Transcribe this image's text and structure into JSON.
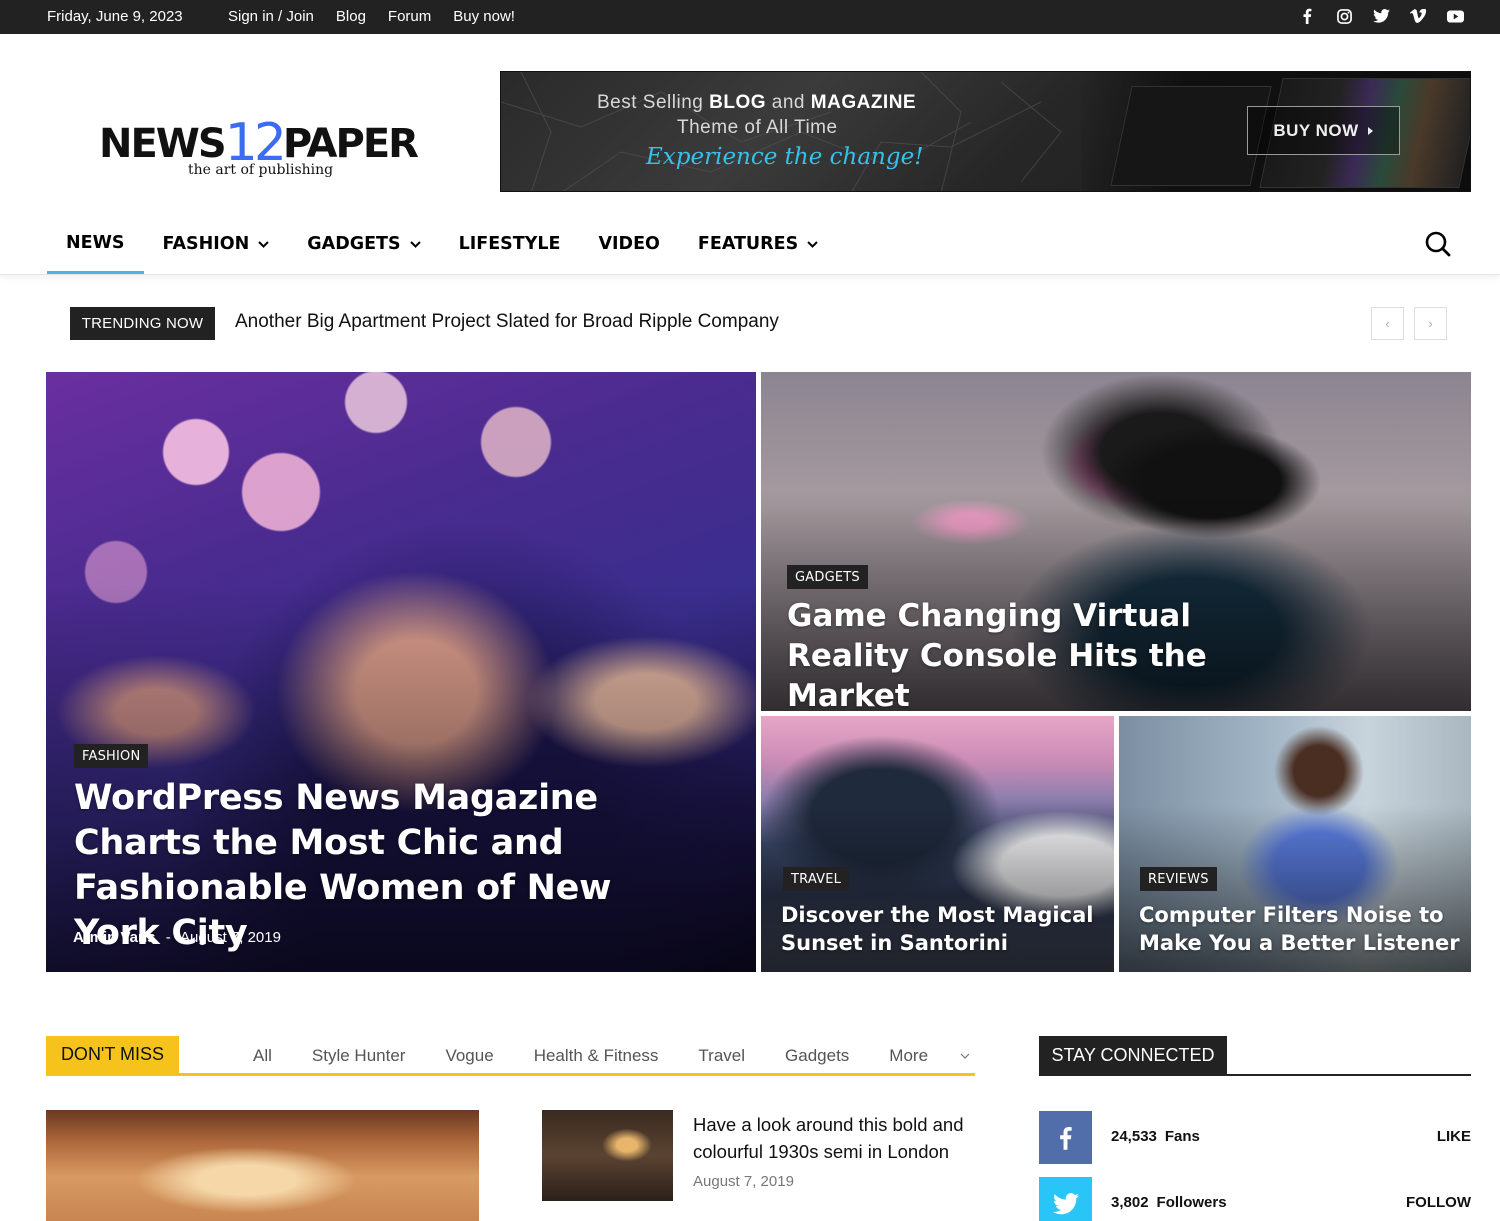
{
  "topbar": {
    "date": "Friday, June 9, 2023",
    "links": [
      "Sign in / Join",
      "Blog",
      "Forum",
      "Buy now!"
    ],
    "social_icons": [
      "facebook-icon",
      "instagram-icon",
      "twitter-icon",
      "vimeo-icon",
      "youtube-icon"
    ]
  },
  "logo": {
    "part1": "NEWS",
    "part2": "12",
    "part3": "PAPER",
    "tagline": "the art of publishing",
    "accent_color": "#3a6cf4"
  },
  "banner": {
    "line1_a": "Best Selling ",
    "line1_b": "BLOG",
    "line1_c": " and ",
    "line1_d": "MAGAZINE",
    "line2": "Theme of All Time",
    "line3": "Experience the change!",
    "button": "BUY NOW"
  },
  "nav": {
    "items": [
      {
        "label": "NEWS",
        "dropdown": false,
        "active": true
      },
      {
        "label": "FASHION",
        "dropdown": true
      },
      {
        "label": "GADGETS",
        "dropdown": true
      },
      {
        "label": "LIFESTYLE",
        "dropdown": false
      },
      {
        "label": "VIDEO",
        "dropdown": false
      },
      {
        "label": "FEATURES",
        "dropdown": true
      }
    ],
    "active_color": "#4db2ec"
  },
  "trending": {
    "tag": "TRENDING NOW",
    "headline": "Another Big Apartment Project Slated for Broad Ripple Company",
    "prev": "‹",
    "next": "›"
  },
  "featured": [
    {
      "category": "FASHION",
      "title": "WordPress News Magazine Charts the Most Chic and Fashionable Women of New York City",
      "author": "Armin Vans",
      "separator": "-",
      "date": "August 7, 2019"
    },
    {
      "category": "GADGETS",
      "title": "Game Changing Virtual Reality Console Hits the Market"
    },
    {
      "category": "TRAVEL",
      "title": "Discover the Most Magical Sunset in Santorini"
    },
    {
      "category": "REVIEWS",
      "title": "Computer Filters Noise to Make You a Better Listener"
    }
  ],
  "dont_miss": {
    "tag": "DON'T MISS",
    "tabs": [
      "All",
      "Style Hunter",
      "Vogue",
      "Health & Fitness",
      "Travel",
      "Gadgets"
    ],
    "more": "More",
    "accent_color": "#f6c31c",
    "post_title": "Have a look around this bold and colourful 1930s semi in London",
    "post_date": "August 7, 2019"
  },
  "stay_connected": {
    "tag": "STAY CONNECTED",
    "rows": [
      {
        "count": "24,533",
        "label": "Fans",
        "action": "LIKE",
        "icon": "facebook-icon",
        "color": "#516eab"
      },
      {
        "count": "3,802",
        "label": "Followers",
        "action": "FOLLOW",
        "icon": "twitter-icon",
        "color": "#29c5f6"
      }
    ]
  }
}
